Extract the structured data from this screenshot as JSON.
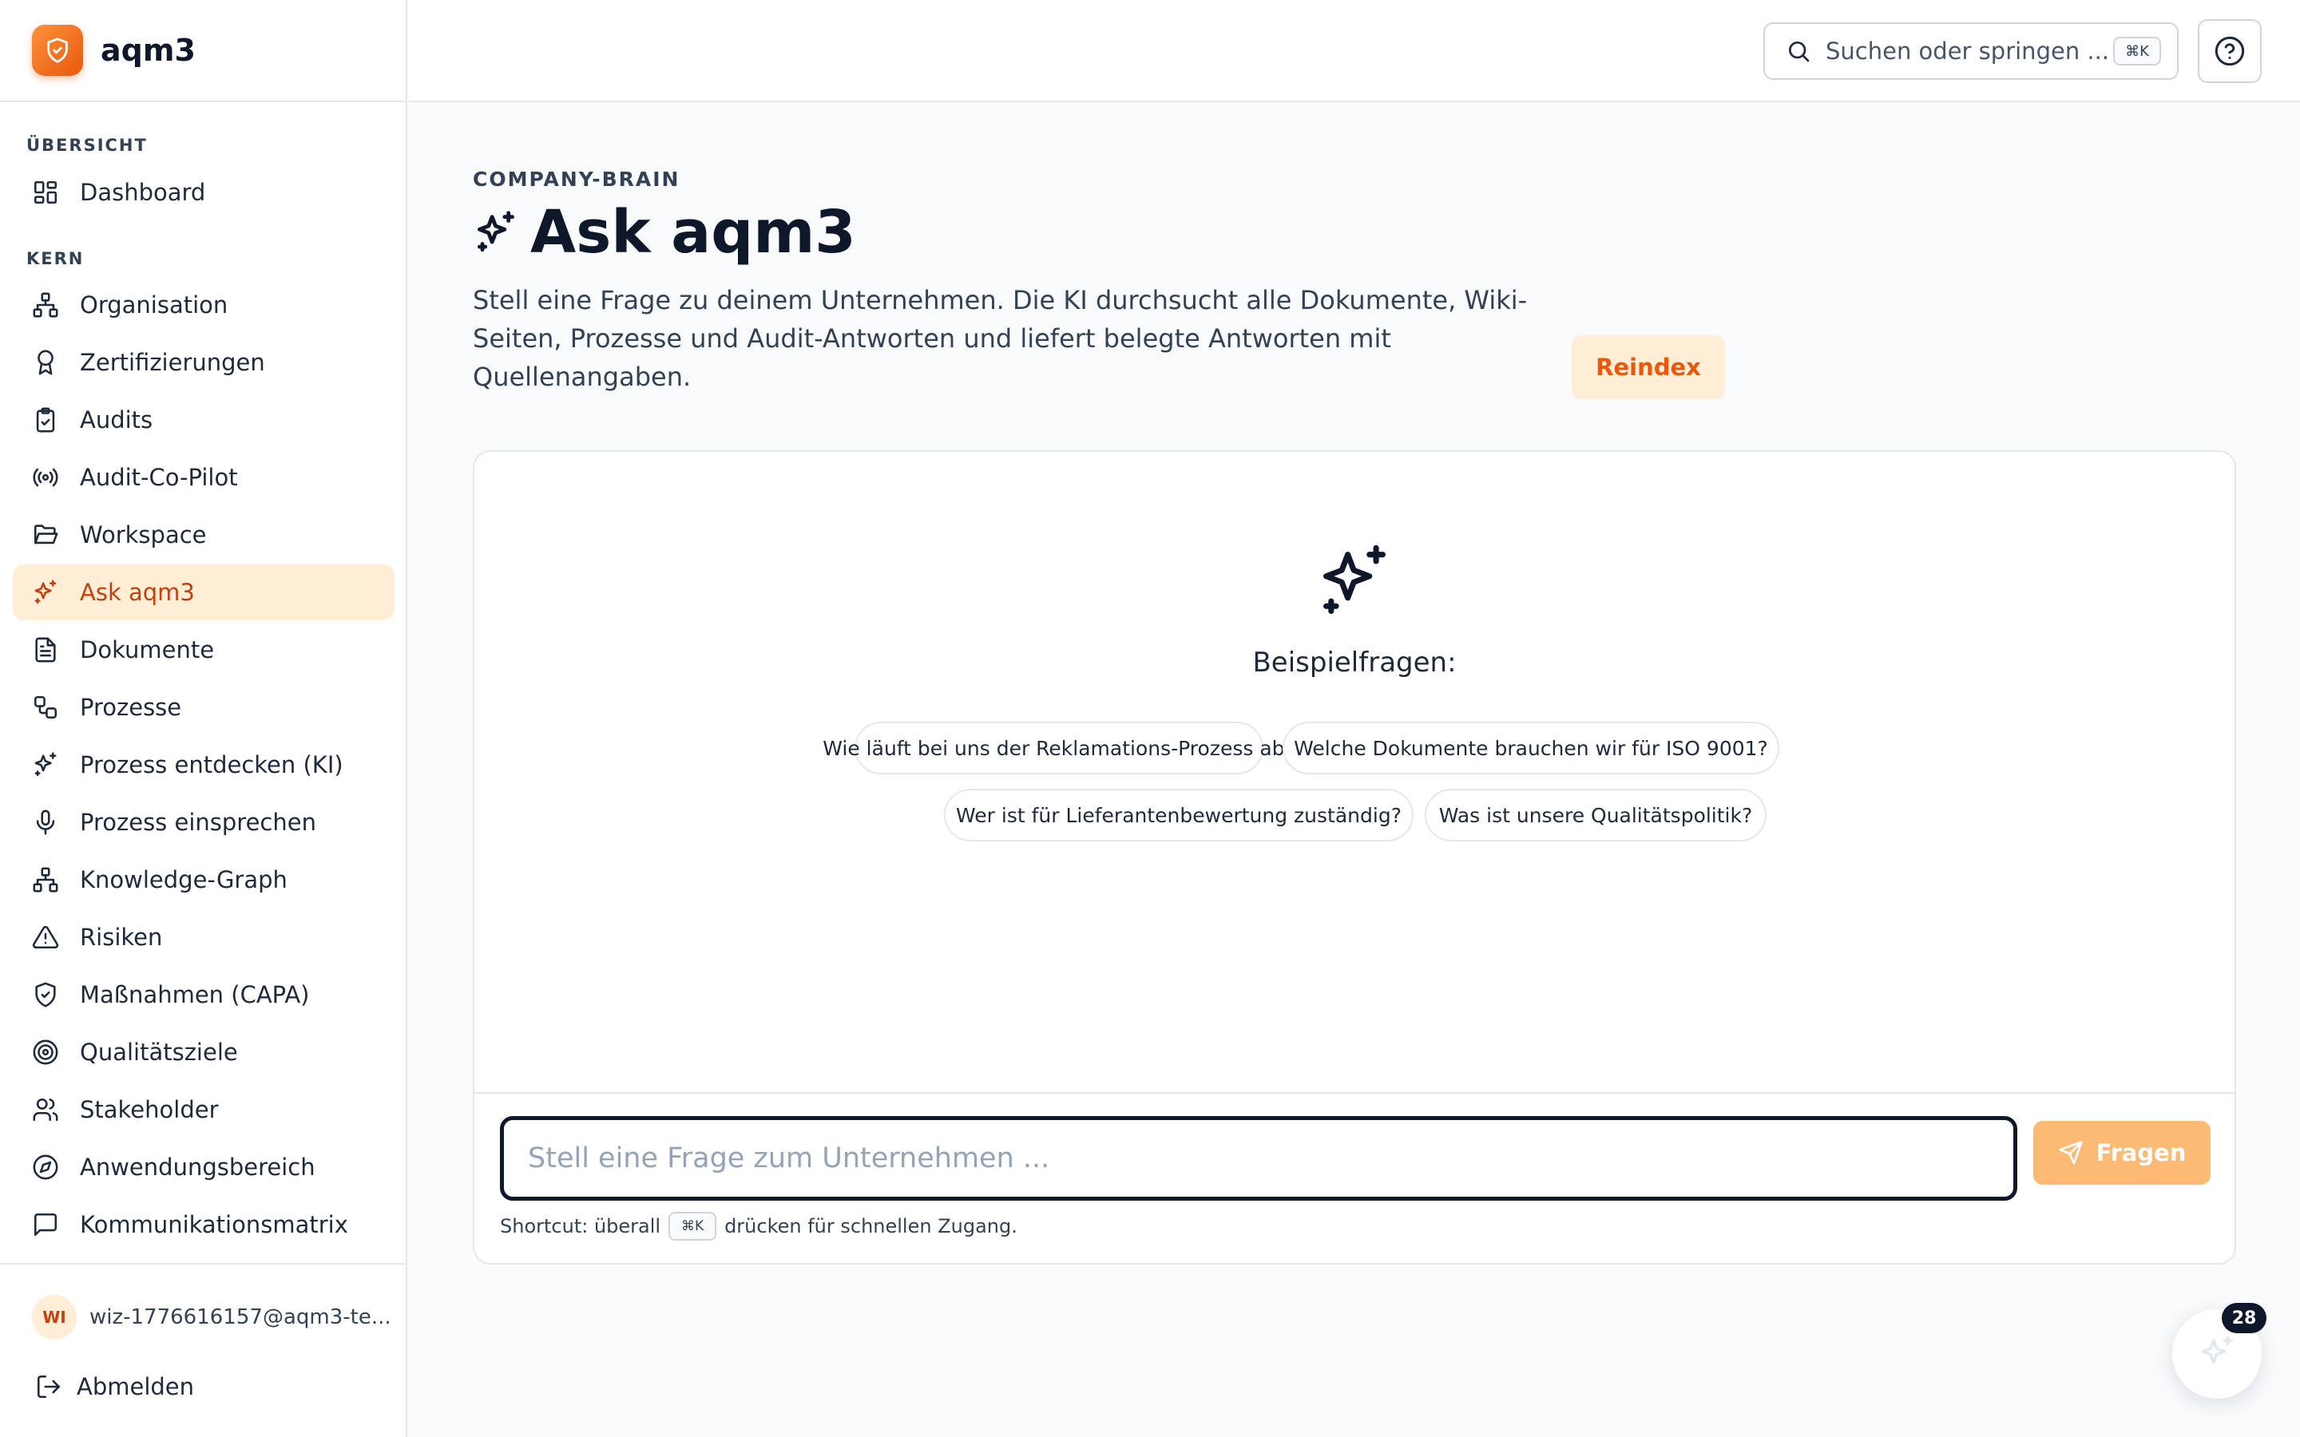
{
  "app": {
    "name": "aqm3"
  },
  "colors": {
    "accent": "#ea580c",
    "accent_light": "#ffedd5",
    "text": "#0f172a",
    "muted": "#334155",
    "border": "#e5e7eb"
  },
  "sidebar": {
    "sections": [
      {
        "label": "ÜBERSICHT"
      },
      {
        "label": "KERN"
      }
    ],
    "items": [
      {
        "label": "Dashboard",
        "icon": "dashboard-icon"
      },
      {
        "label": "Organisation",
        "icon": "org-chart-icon"
      },
      {
        "label": "Zertifizierungen",
        "icon": "award-icon"
      },
      {
        "label": "Audits",
        "icon": "clipboard-check-icon"
      },
      {
        "label": "Audit-Co-Pilot",
        "icon": "radio-icon"
      },
      {
        "label": "Workspace",
        "icon": "folder-open-icon"
      },
      {
        "label": "Ask aqm3",
        "icon": "sparkles-icon",
        "active": true
      },
      {
        "label": "Dokumente",
        "icon": "file-text-icon"
      },
      {
        "label": "Prozesse",
        "icon": "workflow-icon"
      },
      {
        "label": "Prozess entdecken (KI)",
        "icon": "sparkles-icon"
      },
      {
        "label": "Prozess einsprechen",
        "icon": "microphone-icon"
      },
      {
        "label": "Knowledge-Graph",
        "icon": "network-icon"
      },
      {
        "label": "Risiken",
        "icon": "warning-triangle-icon"
      },
      {
        "label": "Maßnahmen (CAPA)",
        "icon": "shield-check-icon"
      },
      {
        "label": "Qualitätsziele",
        "icon": "target-icon"
      },
      {
        "label": "Stakeholder",
        "icon": "users-icon"
      },
      {
        "label": "Anwendungsbereich",
        "icon": "compass-icon"
      },
      {
        "label": "Kommunikationsmatrix",
        "icon": "message-square-icon"
      }
    ],
    "user": {
      "initials": "WI",
      "email": "wiz-1776616157@aqm3-te..."
    },
    "logout_label": "Abmelden"
  },
  "topbar": {
    "search_placeholder": "Suchen oder springen ...",
    "search_shortcut": "⌘K"
  },
  "main": {
    "eyebrow": "COMPANY-BRAIN",
    "title": "Ask aqm3",
    "description": "Stell eine Frage zu deinem Unternehmen. Die KI durchsucht alle Dokumente, Wiki-Seiten, Prozesse und Audit-Antworten und liefert belegte Antworten mit Quellenangaben.",
    "reindex_label": "Reindex"
  },
  "chat": {
    "empty_title": "Beispielfragen:",
    "examples": [
      "Wie läuft bei uns der Reklamations-Prozess ab?",
      "Welche Dokumente brauchen wir für ISO 9001?",
      "Wer ist für Lieferantenbewertung zuständig?",
      "Was ist unsere Qualitätspolitik?"
    ],
    "input_placeholder": "Stell eine Frage zum Unternehmen ...",
    "input_value": "",
    "send_label": "Fragen",
    "shortcut_prefix": "Shortcut: überall",
    "shortcut_key": "⌘K",
    "shortcut_suffix": "drücken für schnellen Zugang."
  },
  "widget": {
    "badge_count": "28"
  }
}
